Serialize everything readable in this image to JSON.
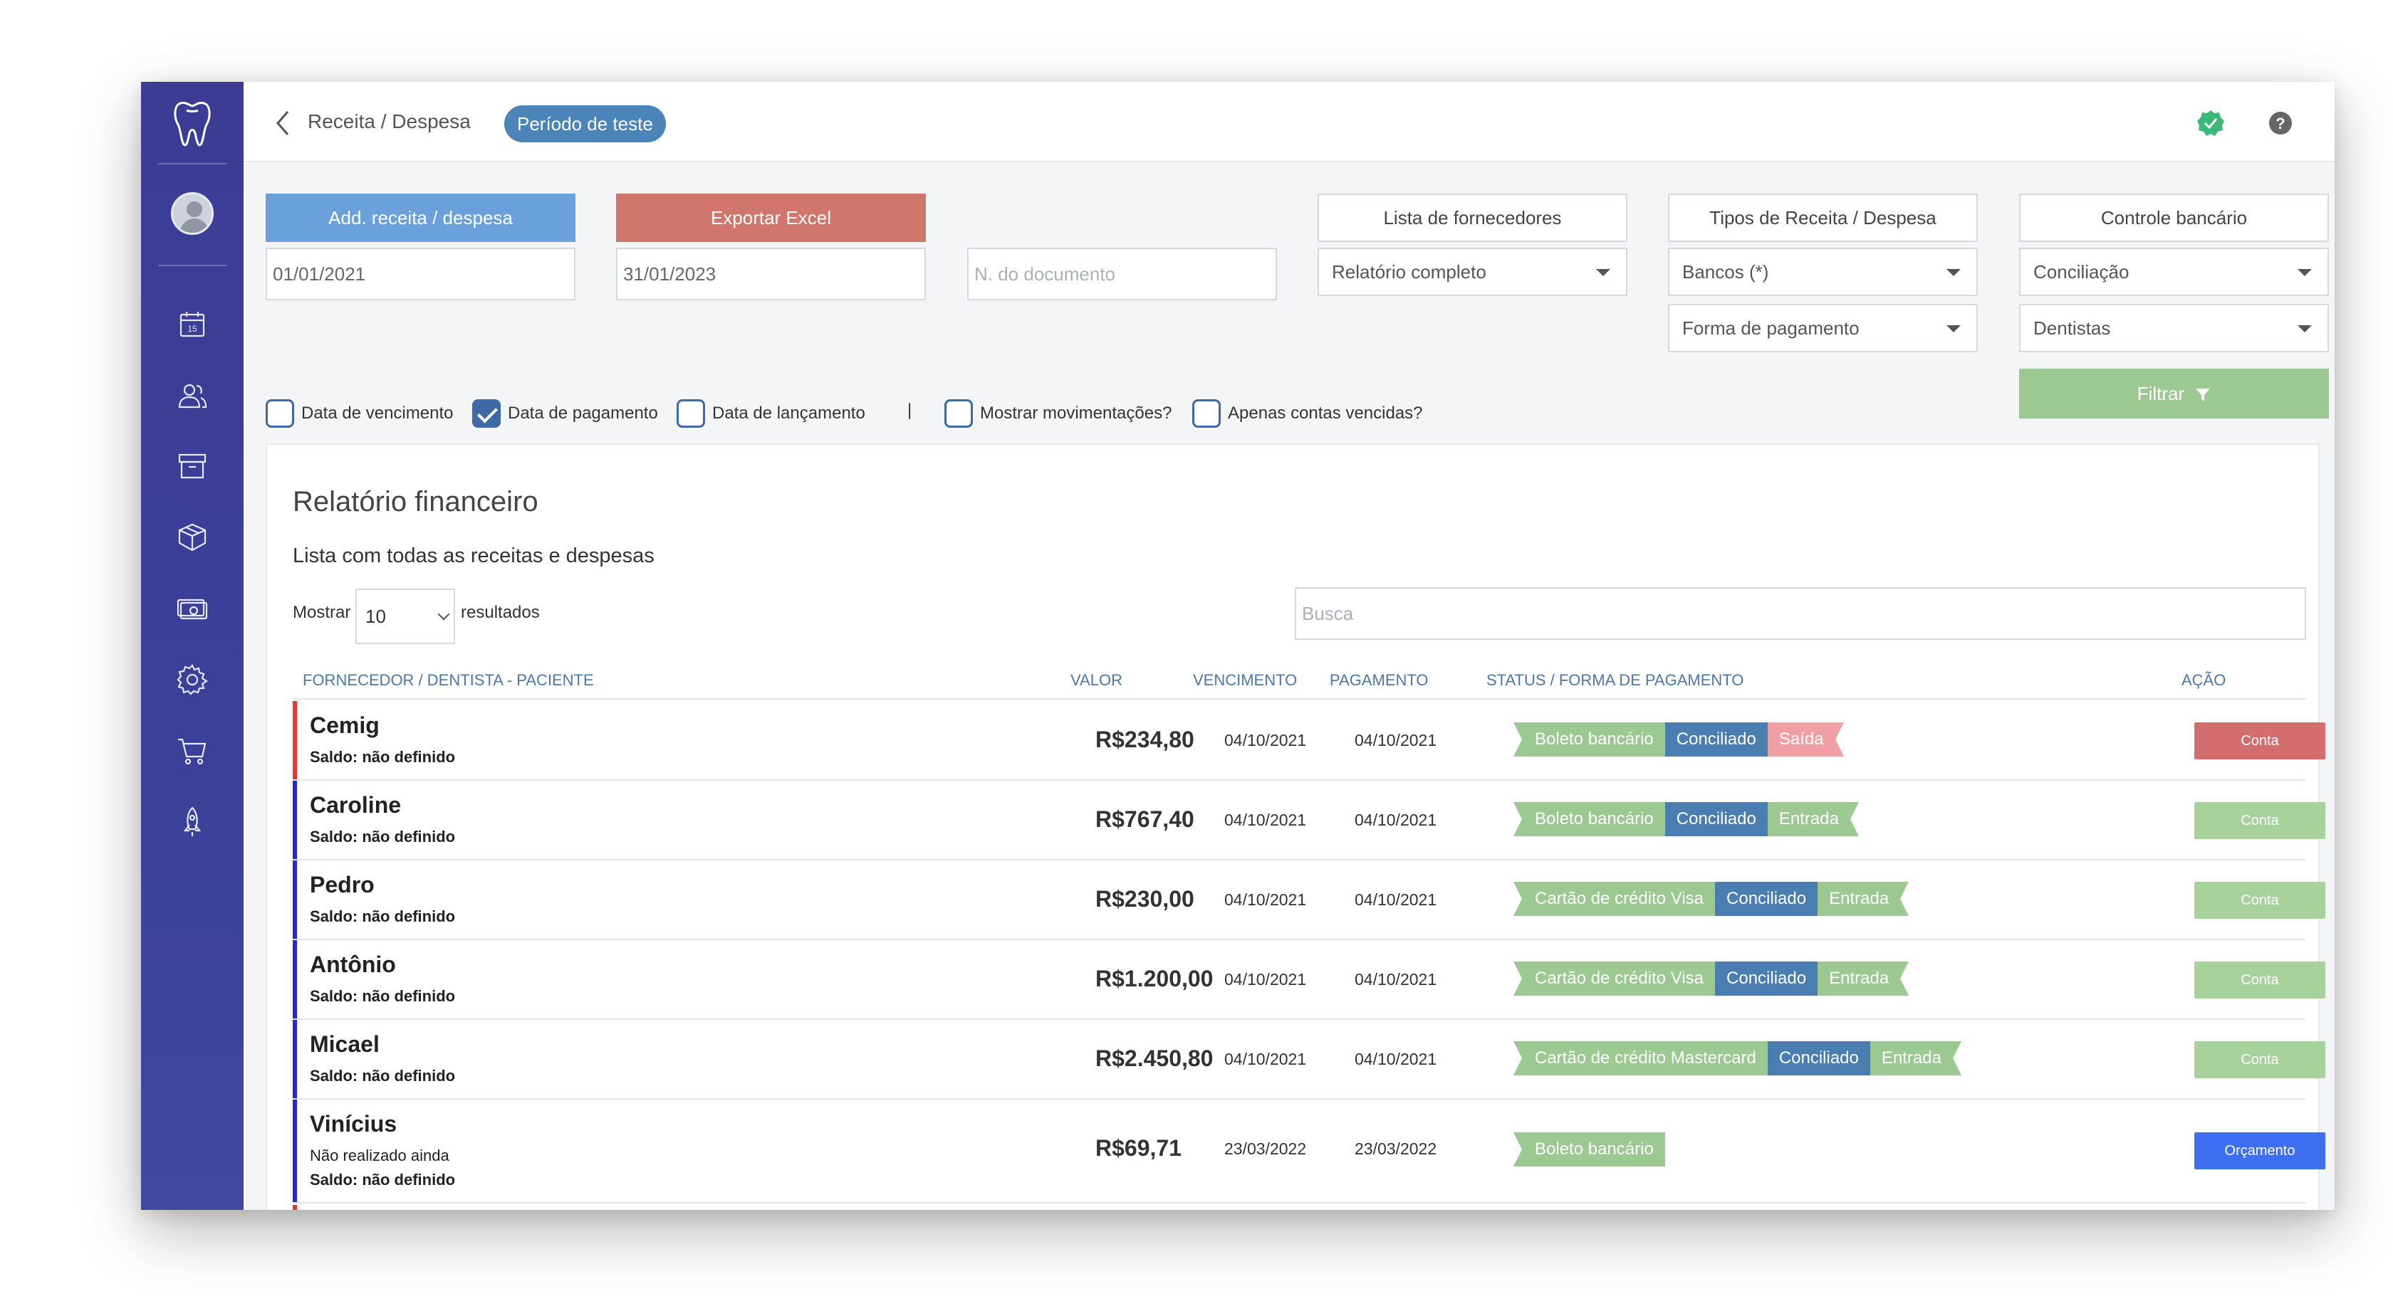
{
  "colors": {
    "sidebar": "#3c3c95",
    "primary_blue": "#6aa0dc",
    "excel_red": "#d0766c",
    "filter_green": "#9cc891",
    "tag_green": "#9cc891",
    "tag_blue": "#4a7db0",
    "tag_pink": "#f0a0a4",
    "row_red": "#e53935",
    "row_blue": "#2626d9",
    "action_red": "#d46d6d",
    "action_blue": "#3e6ef2",
    "badge_blue": "#4b84b8"
  },
  "header": {
    "title": "Receita / Despesa",
    "trial_badge": "Período de teste"
  },
  "sidebar": {
    "icons": [
      "tooth-logo-icon",
      "calendar-icon",
      "users-icon",
      "archive-icon",
      "box-icon",
      "money-icon",
      "gear-icon",
      "cart-icon",
      "rocket-icon"
    ],
    "calendar_day": "15"
  },
  "filters": {
    "add_button": "Add. receita / despesa",
    "export_button": "Exportar Excel",
    "date_from": "01/01/2021",
    "date_to": "31/01/2023",
    "doc_placeholder": "N. do documento",
    "suppliers_button": "Lista de fornecedores",
    "types_button": "Tipos de Receita / Despesa",
    "bank_button": "Controle bancário",
    "report_select": "Relatório completo",
    "banks_select": "Bancos (*)",
    "conciliation_select": "Conciliação",
    "payment_form_select": "Forma de pagamento",
    "dentists_select": "Dentistas",
    "filter_button": "Filtrar",
    "checkboxes": [
      {
        "label": "Data de vencimento",
        "checked": false
      },
      {
        "label": "Data de pagamento",
        "checked": true
      },
      {
        "label": "Data de lançamento",
        "checked": false
      },
      {
        "label": "Mostrar movimentações?",
        "checked": false
      },
      {
        "label": "Apenas contas vencidas?",
        "checked": false
      }
    ],
    "separator": "|"
  },
  "panel": {
    "title": "Relatório financeiro",
    "subtitle": "Lista com todas as receitas e despesas",
    "show_label": "Mostrar",
    "page_size": "10",
    "results_label": "resultados",
    "search_placeholder": "Busca"
  },
  "table": {
    "headers": {
      "name": "FORNECEDOR / DENTISTA - PACIENTE",
      "value": "VALOR",
      "due": "VENCIMENTO",
      "payment": "PAGAMENTO",
      "status": "STATUS / FORMA DE PAGAMENTO",
      "action": "AÇÃO"
    },
    "rows": [
      {
        "name": "Cemig",
        "saldo": "Saldo: não definido",
        "value": "R$234,80",
        "due": "04/10/2021",
        "paid": "04/10/2021",
        "tags": [
          "Boleto bancário",
          "Conciliado",
          "Saída"
        ],
        "action": "Conta"
      },
      {
        "name": "Caroline",
        "saldo": "Saldo: não definido",
        "value": "R$767,40",
        "due": "04/10/2021",
        "paid": "04/10/2021",
        "tags": [
          "Boleto bancário",
          "Conciliado",
          "Entrada"
        ],
        "action": "Conta"
      },
      {
        "name": "Pedro",
        "saldo": "Saldo: não definido",
        "value": "R$230,00",
        "due": "04/10/2021",
        "paid": "04/10/2021",
        "tags": [
          "Cartão de crédito Visa",
          "Conciliado",
          "Entrada"
        ],
        "action": "Conta"
      },
      {
        "name": "Antônio",
        "saldo": "Saldo: não definido",
        "value": "R$1.200,00",
        "due": "04/10/2021",
        "paid": "04/10/2021",
        "tags": [
          "Cartão de crédito Visa",
          "Conciliado",
          "Entrada"
        ],
        "action": "Conta"
      },
      {
        "name": "Micael",
        "saldo": "Saldo: não definido",
        "value": "R$2.450,80",
        "due": "04/10/2021",
        "paid": "04/10/2021",
        "tags": [
          "Cartão de crédito Mastercard",
          "Conciliado",
          "Entrada"
        ],
        "action": "Conta"
      },
      {
        "name": "Vinícius",
        "note": "Não realizado ainda",
        "saldo": "Saldo: não definido",
        "value": "R$69,71",
        "due": "23/03/2022",
        "paid": "23/03/2022",
        "tags": [
          "Boleto bancário"
        ],
        "action": "Orçamento"
      }
    ]
  }
}
